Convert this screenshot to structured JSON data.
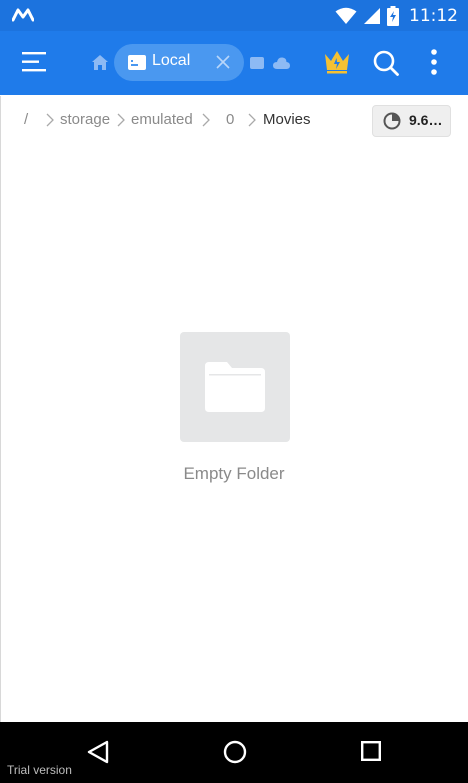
{
  "status_bar": {
    "time": "11:12",
    "icons": [
      "app-logo-icon",
      "wifi-icon",
      "signal-icon",
      "battery-charging-icon"
    ]
  },
  "toolbar": {
    "menu_icon": "hamburger-menu-icon",
    "home_icon": "home-icon",
    "active_tab": {
      "label": "Local",
      "icon": "storage-icon",
      "close_icon": "close-icon"
    },
    "other_tabs": [
      "tab-icon",
      "cloud-icon"
    ],
    "actions": [
      "crown-icon",
      "search-icon",
      "more-vert-icon"
    ]
  },
  "breadcrumb": {
    "items": [
      "/",
      "storage",
      "emulated",
      "0",
      "Movies"
    ],
    "storage_label": "9.6…"
  },
  "main": {
    "empty_label": "Empty Folder"
  },
  "navbar": {
    "icons": [
      "back-icon",
      "home-circle-icon",
      "recent-apps-icon"
    ],
    "trial_label": "Trial version"
  },
  "colors": {
    "primary": "#1F7BEA",
    "status_bar": "#1C73DE",
    "tab_pill": "#4A98F0",
    "crown": "#F4C133"
  }
}
